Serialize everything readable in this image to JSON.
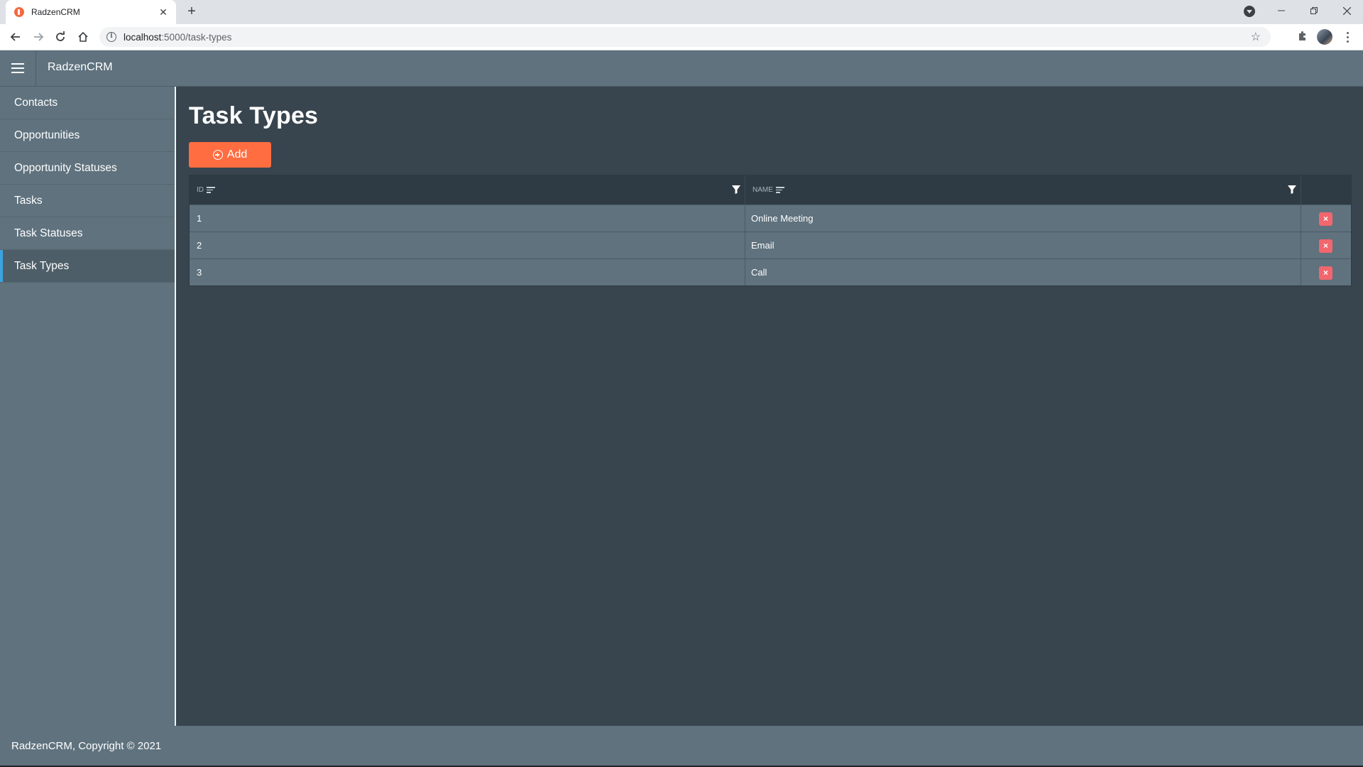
{
  "browser": {
    "tab_title": "RadzenCRM",
    "url_host": "localhost",
    "url_path": ":5000/task-types"
  },
  "app": {
    "title": "RadzenCRM"
  },
  "sidebar": {
    "items": [
      {
        "label": "Contacts"
      },
      {
        "label": "Opportunities"
      },
      {
        "label": "Opportunity Statuses"
      },
      {
        "label": "Tasks"
      },
      {
        "label": "Task Statuses"
      },
      {
        "label": "Task Types"
      }
    ],
    "active_index": 5
  },
  "page": {
    "title": "Task Types",
    "add_label": "Add"
  },
  "grid": {
    "columns": [
      "ID",
      "NAME"
    ],
    "rows": [
      {
        "id": "1",
        "name": "Online Meeting"
      },
      {
        "id": "2",
        "name": "Email"
      },
      {
        "id": "3",
        "name": "Call"
      }
    ],
    "delete_glyph": "×"
  },
  "footer": {
    "text": "RadzenCRM, Copyright © 2021"
  },
  "colors": {
    "accent": "#ff6d41",
    "danger": "#f2666d",
    "header": "#5f727e",
    "content_bg": "#38454e",
    "active_marker": "#3ba4e0"
  }
}
